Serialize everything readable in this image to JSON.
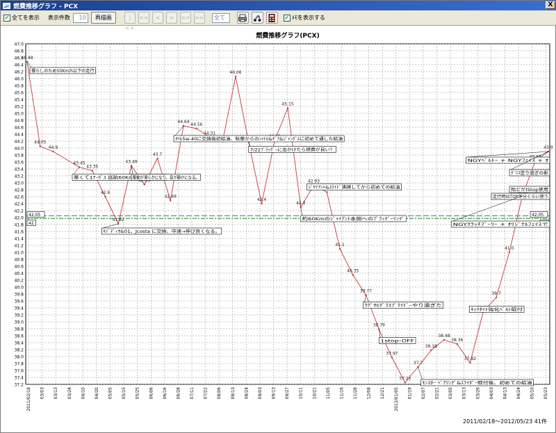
{
  "window": {
    "title": "燃費推移グラフ - PCX",
    "close_label": "X"
  },
  "toolbar": {
    "show_all_label": "全てを表示",
    "display_count_label": "表示件数",
    "display_count_value": "10",
    "redraw_label": "再描画",
    "nav_first": "|<<",
    "nav_prev": "<<",
    "nav_back": "<",
    "nav_next": ">",
    "nav_forward": ">>",
    "nav_last": ">>|",
    "filter_value": "全て",
    "show_notes_label": "ﾒﾓを表示する"
  },
  "colors": {
    "line": "#c0393b",
    "avg_line": "#4a6fb0",
    "ref_line": "#3a9a3a",
    "grid": "#8c8c8c"
  },
  "chart_data": {
    "type": "line",
    "title": "燃費推移グラフ(PCX)",
    "ylim": [
      37.2,
      47.0
    ],
    "y_ticks": [
      "47.0",
      "46.8",
      "46.6",
      "46.4",
      "46.2",
      "46.0",
      "45.8",
      "45.6",
      "45.4",
      "45.2",
      "45.0",
      "44.8",
      "44.6",
      "44.4",
      "44.2",
      "44.0",
      "43.8",
      "43.6",
      "43.4",
      "43.2",
      "43.0",
      "42.8",
      "42.6",
      "42.4",
      "42.2",
      "42.0",
      "41.8",
      "41.6",
      "41.4",
      "41.2",
      "41.0",
      "40.8",
      "40.6",
      "40.4",
      "40.2",
      "40.0",
      "39.8",
      "39.6",
      "39.4",
      "39.2",
      "39.0",
      "38.8",
      "38.6",
      "38.4",
      "38.2",
      "38.0",
      "37.8",
      "37.6",
      "37.4",
      "37.2"
    ],
    "x_labels": [
      "2011/02/18",
      "03/03",
      "03/13",
      "03/24",
      "04/10",
      "04/20",
      "05/05",
      "05/15",
      "05/25",
      "06/06",
      "06/16",
      "06/28",
      "07/11",
      "07/22",
      "08/06",
      "08/13",
      "08/24",
      "09/03",
      "09/13",
      "09/27",
      "10/11",
      "10/21",
      "11/05",
      "11/16",
      "11/28",
      "12/08",
      "12/21",
      "2012/01/05",
      "01/19",
      "02/07",
      "02/21",
      "03/05",
      "03/13",
      "03/26",
      "04/03",
      "04/13",
      "04/24",
      "05/10",
      "05/23"
    ],
    "grid": true,
    "reference_lines": [
      {
        "value": 42.05,
        "label": "42.05",
        "style": "avg"
      },
      {
        "value": 41.97,
        "label": "42",
        "style": "ref"
      }
    ],
    "series": [
      {
        "values": [
          46.48,
          44.05,
          43.9,
          null,
          43.45,
          43.35,
          42.6,
          41.82,
          43.49,
          42.95,
          43.7,
          42.49,
          44.64,
          44.56,
          44.31,
          44.19,
          46.06,
          44.17,
          42.4,
          44.22,
          45.15,
          42.3,
          42.93,
          42.73,
          41.1,
          40.35,
          39.77,
          38.79,
          37.97,
          37.25,
          37.7,
          38.18,
          38.48,
          38.36,
          37.82,
          39.29,
          39.7,
          41.0,
          42.62,
          43.63,
          43.9
        ]
      }
    ],
    "point_labels": [
      "46.48",
      "44.05",
      "44.9",
      "43.45",
      "43.35",
      "42.6",
      "41.82",
      "43.49",
      "42.95",
      "43.7",
      "42.49",
      "44.64",
      "44.56",
      "44.31",
      "44.19",
      "46.06",
      "44.17",
      "42.4",
      "44.22",
      "45.15",
      "42.3",
      "42.93",
      "42.73",
      "41.1",
      "40.35",
      "39.77",
      "38.79",
      "37.97",
      "37.25",
      "37.7",
      "38.18",
      "38.48",
      "38.36",
      "37.82",
      "39.29",
      "39.7",
      "41.0",
      "42.62",
      "43.63",
      "43.9"
    ],
    "annotations": [
      {
        "text": "慣らしのため50Km/h以下の走行"
      },
      {
        "text": "寒くて1ｱｰﾎﾞｽ 巡航60Km/h、無限ﾏﾌﾗｰ"
      },
      {
        "text": "ｷｼﾞﾃﾞｨｵ&01、Jcosta に交換、中速→伸び良くなる。"
      },
      {
        "text": "駆動が滑らかになり、音が静かになる。"
      },
      {
        "text": "ｵｲﾙ5w-40に交換後初給油、秋葉からのｼｬﾄﾙ&ｷﾞｱ&ｼﾞｬﾝｸﾞﾙに初めて通した給油"
      },
      {
        "text": "7/22ﾌﾞﾗｯｸﾞｰに出かけたら燃費が良い？"
      },
      {
        "text": "約60Kmのｼﾞｬｲｱﾝﾄ本田へのﾌﾞﾗｯｸﾞｰﾘﾝｸﾞ"
      },
      {
        "text": "ｼﾞﾔｲｱﾝﾄ&ｽﾗｲﾄﾞ清掃してから初めての給油"
      },
      {
        "text": "ｳｸﾞｻﾙｸﾞﾗｽﾌﾟﾗｲﾄﾞｰやり過ぎた"
      },
      {
        "text": "1stop-OFF"
      },
      {
        "text": "ﾓﾝｽﾀｰ ﾍﾞｱﾘﾝｸﾞ&ｽﾗｲﾀﾞｰ取付後、初めての給油"
      },
      {
        "text": "ｷｯｸﾀｲﾄ強化ﾍﾞﾙﾄ取付"
      },
      {
        "text": "殆どがIStop使用"
      },
      {
        "text": "走行時ISTOP半分ぐらい使う"
      },
      {
        "text": "NGYﾍﾞﾙﾄｰ + NGYﾌｪｲｽ + ｵ"
      },
      {
        "text": "ｸﾞﾘｽ塗り過ぎの影"
      },
      {
        "text": "NGYｸﾗｯﾁﾌﾞｰﾘｰ + ｵﾘｼﾞﾅﾙﾌｪｲｽで"
      }
    ]
  },
  "footer": {
    "range": "2011/02/18～2012/05/23  41件"
  }
}
